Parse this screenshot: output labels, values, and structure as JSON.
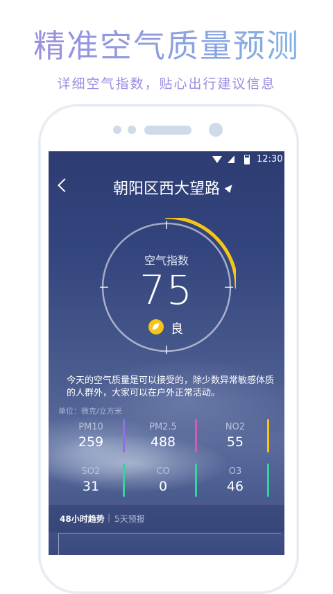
{
  "promo": {
    "headline": "精准空气质量预测",
    "subhead": "详细空气指数，贴心出行建议信息"
  },
  "status_bar": {
    "time": "12:30"
  },
  "header": {
    "title": "朝阳区西大望路"
  },
  "gauge": {
    "label": "空气指数",
    "value": "75",
    "grade": "良",
    "arc_color": "#f5c518"
  },
  "advice": "今天的空气质量是可以接受的，除少数异常敏感体质的人群外，大家可以在户外正常活动。",
  "unit_label": "单位：微克/立方米",
  "pollutants": [
    {
      "name": "PM10",
      "value": "259",
      "color": "#8f6fe3"
    },
    {
      "name": "PM2.5",
      "value": "488",
      "color": "#d65ab0"
    },
    {
      "name": "NO2",
      "value": "55",
      "color": "#f5c518"
    },
    {
      "name": "SO2",
      "value": "31",
      "color": "#36d39a"
    },
    {
      "name": "CO",
      "value": "0",
      "color": "#36d39a"
    },
    {
      "name": "O3",
      "value": "46",
      "color": "#36d39a"
    }
  ],
  "tabs": {
    "trend_48h": "48小时趋势",
    "separator": "|",
    "forecast_5d": "5天预报"
  }
}
